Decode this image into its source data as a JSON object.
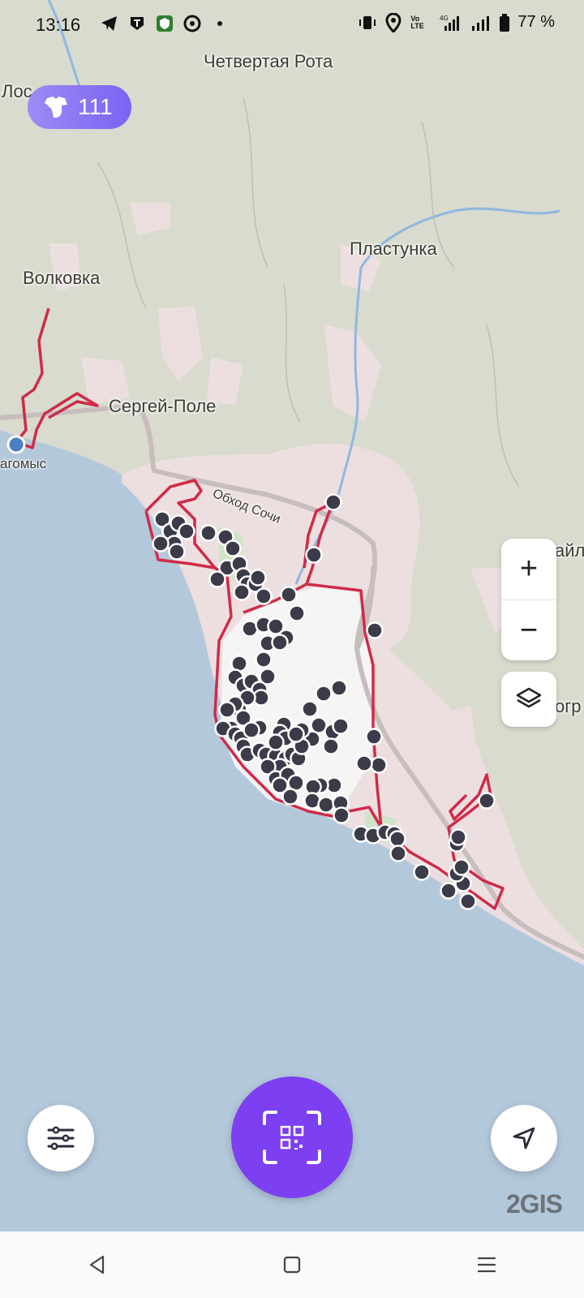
{
  "status_bar": {
    "time": "13:16",
    "battery": "77 %",
    "network_badge": "4G",
    "volte": "Vo LTE",
    "app_icons": [
      "telegram-icon",
      "t-bank-icon",
      "shield-vpn-icon",
      "chat-app-icon",
      "more-dot-icon"
    ],
    "right_icons": [
      "vibrate-icon",
      "location-icon",
      "volte-icon",
      "signal-4g-icon",
      "signal-icon",
      "battery-icon"
    ]
  },
  "map": {
    "labels": {
      "chetvertaya_rota": "Четвертая Рота",
      "los": "Лос",
      "plastunka": "Пластунка",
      "volkovka": "Волковка",
      "sergey_pole": "Сергей-Поле",
      "dagomys": "агомыс",
      "obkhod_sochi": "Обход Сочи",
      "right_ail": "айл",
      "right_ogr": "огр"
    },
    "colors": {
      "land": "#d8dbcd",
      "sea": "#b3c9dd",
      "urban": "#f1e1e3",
      "boundary": "#d02a48",
      "marker": "#3c3b49",
      "river": "#8fb8e0"
    },
    "marker_count_shown": "many"
  },
  "coins": {
    "value": "111",
    "icon": "tshirt-coin-icon"
  },
  "controls": {
    "zoom_in": "+",
    "zoom_out": "−",
    "layers_icon": "layers-icon",
    "filter_icon": "filter-icon",
    "qr_icon": "qr-scan-icon",
    "locate_icon": "navigation-arrow-icon"
  },
  "brand": "2GIS",
  "nav": {
    "back_icon": "back-triangle-icon",
    "home_icon": "home-square-icon",
    "menu_icon": "menu-lines-icon"
  }
}
